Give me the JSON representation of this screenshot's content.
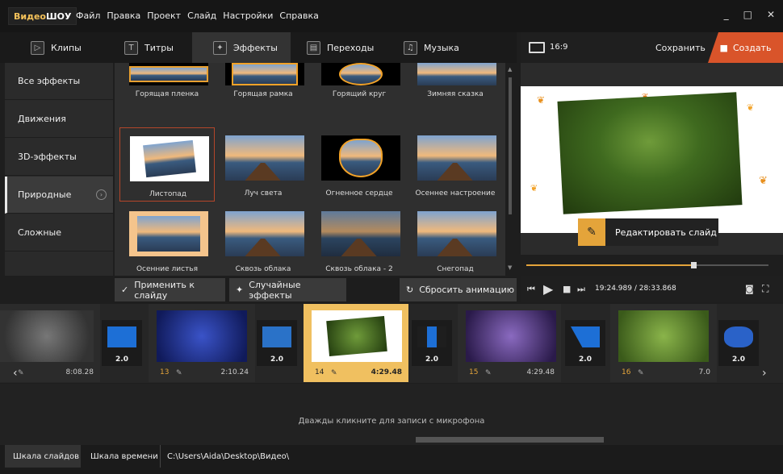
{
  "app": {
    "logo_part1": "Видео",
    "logo_part2": "ШОУ"
  },
  "menu": [
    "Файл",
    "Правка",
    "Проект",
    "Слайд",
    "Настройки",
    "Справка"
  ],
  "window": {
    "minimize": "_",
    "maximize": "□",
    "close": "✕"
  },
  "tabs": [
    {
      "label": "Клипы",
      "icon": "play-icon"
    },
    {
      "label": "Титры",
      "icon": "text-icon"
    },
    {
      "label": "Эффекты",
      "icon": "wand-icon"
    },
    {
      "label": "Переходы",
      "icon": "film-icon"
    },
    {
      "label": "Музыка",
      "icon": "music-icon"
    }
  ],
  "preview_header": {
    "aspect": "16:9",
    "save": "Сохранить",
    "create": "Создать"
  },
  "categories": [
    "Все эффекты",
    "Движения",
    "3D-эффекты",
    "Природные",
    "Сложные"
  ],
  "effects": [
    {
      "label": "Горящая пленка"
    },
    {
      "label": "Горящая рамка"
    },
    {
      "label": "Горящий круг"
    },
    {
      "label": "Зимняя сказка"
    },
    {
      "label": "Листопад"
    },
    {
      "label": "Луч света"
    },
    {
      "label": "Огненное сердце"
    },
    {
      "label": "Осеннее настроение"
    },
    {
      "label": "Осенние листья"
    },
    {
      "label": "Сквозь облака"
    },
    {
      "label": "Сквозь облака - 2"
    },
    {
      "label": "Снегопад"
    }
  ],
  "actions": {
    "apply": "Применить к слайду",
    "random": "Случайные эффекты",
    "reset": "Сбросить анимацию"
  },
  "preview": {
    "edit": "Редактировать слайд",
    "time": "19:24.989 / 28:33.868",
    "progress": 0.69
  },
  "slides": [
    {
      "num": "",
      "dur": "8:08.28"
    },
    {
      "num": "13",
      "dur": "2:10.24"
    },
    {
      "num": "14",
      "dur": "4:29.48"
    },
    {
      "num": "15",
      "dur": "4:29.48"
    },
    {
      "num": "16",
      "dur": "7.0"
    }
  ],
  "transitions": [
    "2.0",
    "2.0",
    "2.0",
    "2.0",
    "2.0"
  ],
  "audio_hint": "Дважды кликните для записи с микрофона",
  "bottom": {
    "tab1": "Шкала слайдов",
    "tab2": "Шкала времени",
    "path": "C:\\Users\\Aida\\Desktop\\Видео\\"
  },
  "colors": {
    "accent": "#e4a43a",
    "create": "#d9542a"
  }
}
